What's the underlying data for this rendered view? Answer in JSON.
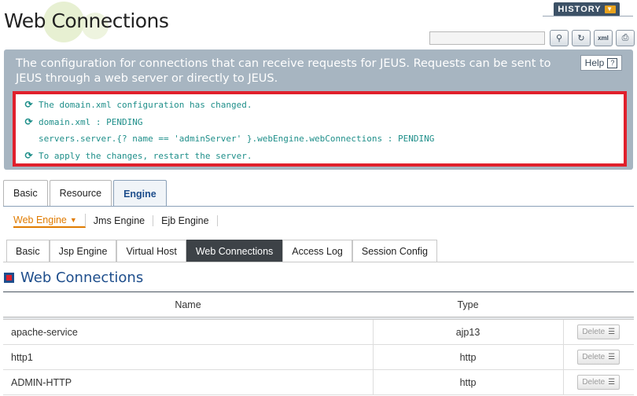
{
  "page": {
    "title": "Web Connections",
    "history_label": "HISTORY",
    "search_value": ""
  },
  "toolbar": {
    "icons": [
      "search-icon",
      "refresh-icon",
      "export-xml-icon",
      "print-icon"
    ]
  },
  "info": {
    "description": "The configuration for connections that can receive requests for JEUS. Requests can be sent to JEUS through a web server or directly to JEUS.",
    "help_label": "Help",
    "help_glyph": "?"
  },
  "messages": [
    {
      "text": "The domain.xml configuration has changed.",
      "icon": true
    },
    {
      "text": "domain.xml : PENDING",
      "icon": true
    },
    {
      "text": "servers.server.{? name == 'adminServer' }.webEngine.webConnections : PENDING",
      "icon": false
    },
    {
      "text": "To apply the changes, restart the server.",
      "icon": true
    }
  ],
  "tabs1": [
    {
      "label": "Basic"
    },
    {
      "label": "Resource"
    },
    {
      "label": "Engine",
      "active": true
    }
  ],
  "subnav": [
    {
      "label": "Web Engine",
      "active": true
    },
    {
      "label": "Jms Engine"
    },
    {
      "label": "Ejb Engine"
    }
  ],
  "tabs2": [
    {
      "label": "Basic"
    },
    {
      "label": "Jsp Engine"
    },
    {
      "label": "Virtual Host"
    },
    {
      "label": "Web Connections",
      "active": true
    },
    {
      "label": "Access Log"
    },
    {
      "label": "Session Config"
    }
  ],
  "section": {
    "title": "Web Connections"
  },
  "table": {
    "headers": [
      "Name",
      "Type"
    ],
    "delete_label": "Delete",
    "rows": [
      {
        "name": "apache-service",
        "type": "ajp13"
      },
      {
        "name": "http1",
        "type": "http"
      },
      {
        "name": "ADMIN-HTTP",
        "type": "http"
      }
    ]
  },
  "colors": {
    "info_bg": "#a7b5c1",
    "alert_border": "#e0202c",
    "message_text": "#1f8f8a",
    "title_blue": "#1e4e8c",
    "active_tab_bg": "#3d4247",
    "active_subnav": "#e07b00"
  }
}
